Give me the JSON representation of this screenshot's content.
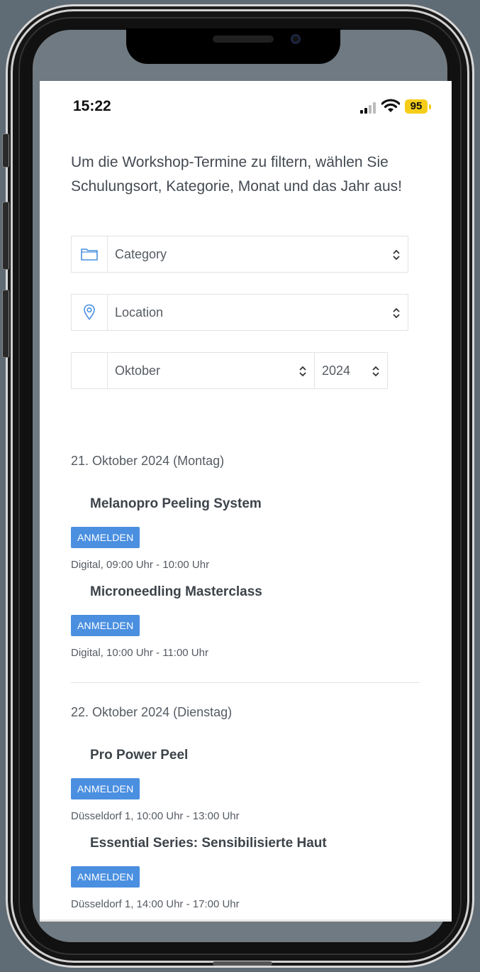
{
  "status_bar": {
    "time": "15:22",
    "battery": "95"
  },
  "intro_text": "Um die Workshop-Termine zu filtern, wählen Sie Schulungsort, Kategorie, Monat und das Jahr aus!",
  "filters": {
    "category": {
      "value": "Category",
      "icon": "folder-icon"
    },
    "location": {
      "value": "Location",
      "icon": "location-pin-icon"
    },
    "month": {
      "value": "Oktober"
    },
    "year": {
      "value": "2024"
    }
  },
  "days": [
    {
      "date": "21. Oktober 2024 (Montag)",
      "events": [
        {
          "title": "Melanopro Peeling System",
          "button": "ANMELDEN",
          "meta": "Digital, 09:00 Uhr - 10:00 Uhr"
        },
        {
          "title": "Microneedling Masterclass",
          "button": "ANMELDEN",
          "meta": "Digital, 10:00 Uhr - 11:00 Uhr"
        }
      ]
    },
    {
      "date": "22. Oktober 2024 (Dienstag)",
      "events": [
        {
          "title": "Pro Power Peel",
          "button": "ANMELDEN",
          "meta": "Düsseldorf 1, 10:00 Uhr - 13:00 Uhr"
        },
        {
          "title": "Essential Series: Sensibilisierte Haut",
          "button": "ANMELDEN",
          "meta": "Düsseldorf 1, 14:00 Uhr - 17:00 Uhr"
        }
      ]
    }
  ],
  "colors": {
    "accent": "#4a8fe0",
    "battery": "#f5cd17",
    "text": "#444a52"
  }
}
